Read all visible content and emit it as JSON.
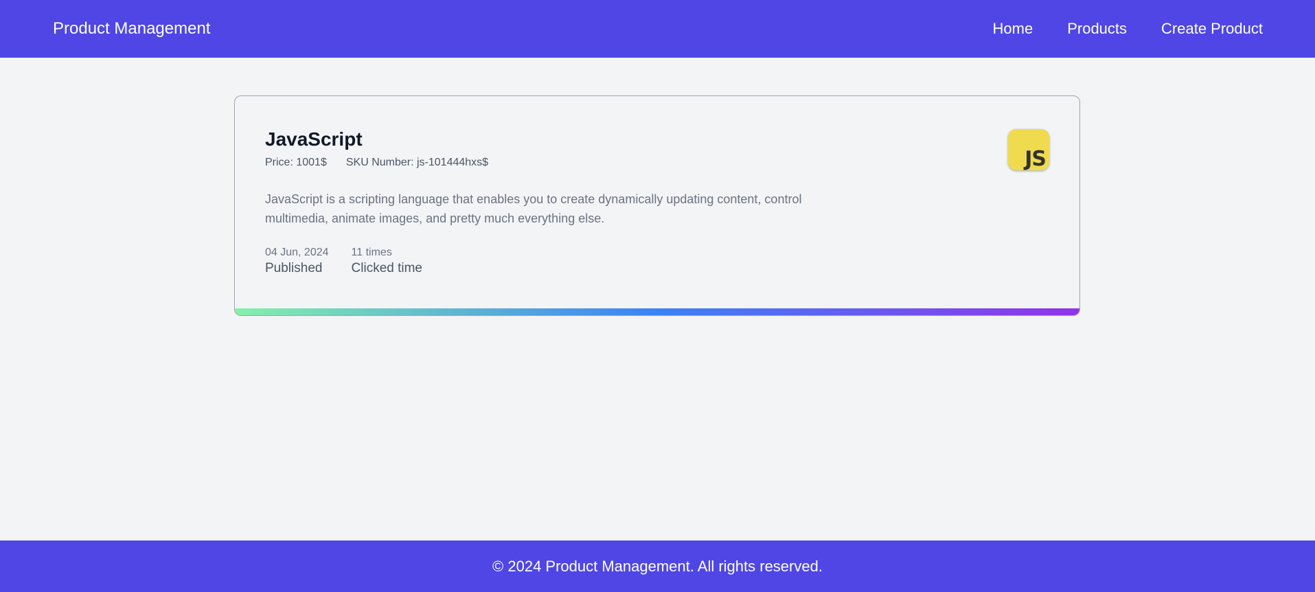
{
  "app": {
    "brand": "Product Management"
  },
  "nav": {
    "items": [
      {
        "label": "Home"
      },
      {
        "label": "Products"
      },
      {
        "label": "Create Product"
      }
    ]
  },
  "product": {
    "title": "JavaScript",
    "price": "Price: 1001$",
    "sku": "SKU Number: js-101444hxs$",
    "description": "JavaScript is a scripting language that enables you to create dynamically updating content, control multimedia, animate images, and pretty much everything else.",
    "logo_text": "JS",
    "logo_color": "#f0db4f",
    "stats": [
      {
        "value": "04 Jun, 2024",
        "label": "Published"
      },
      {
        "value": "11 times",
        "label": "Clicked time"
      }
    ]
  },
  "footer": {
    "text": "© 2024 Product Management. All rights reserved."
  },
  "colors": {
    "primary": "#4f46e5",
    "background": "#f3f4f6",
    "gradient_start": "#86efac",
    "gradient_mid": "#3b82f6",
    "gradient_end": "#9333ea"
  }
}
